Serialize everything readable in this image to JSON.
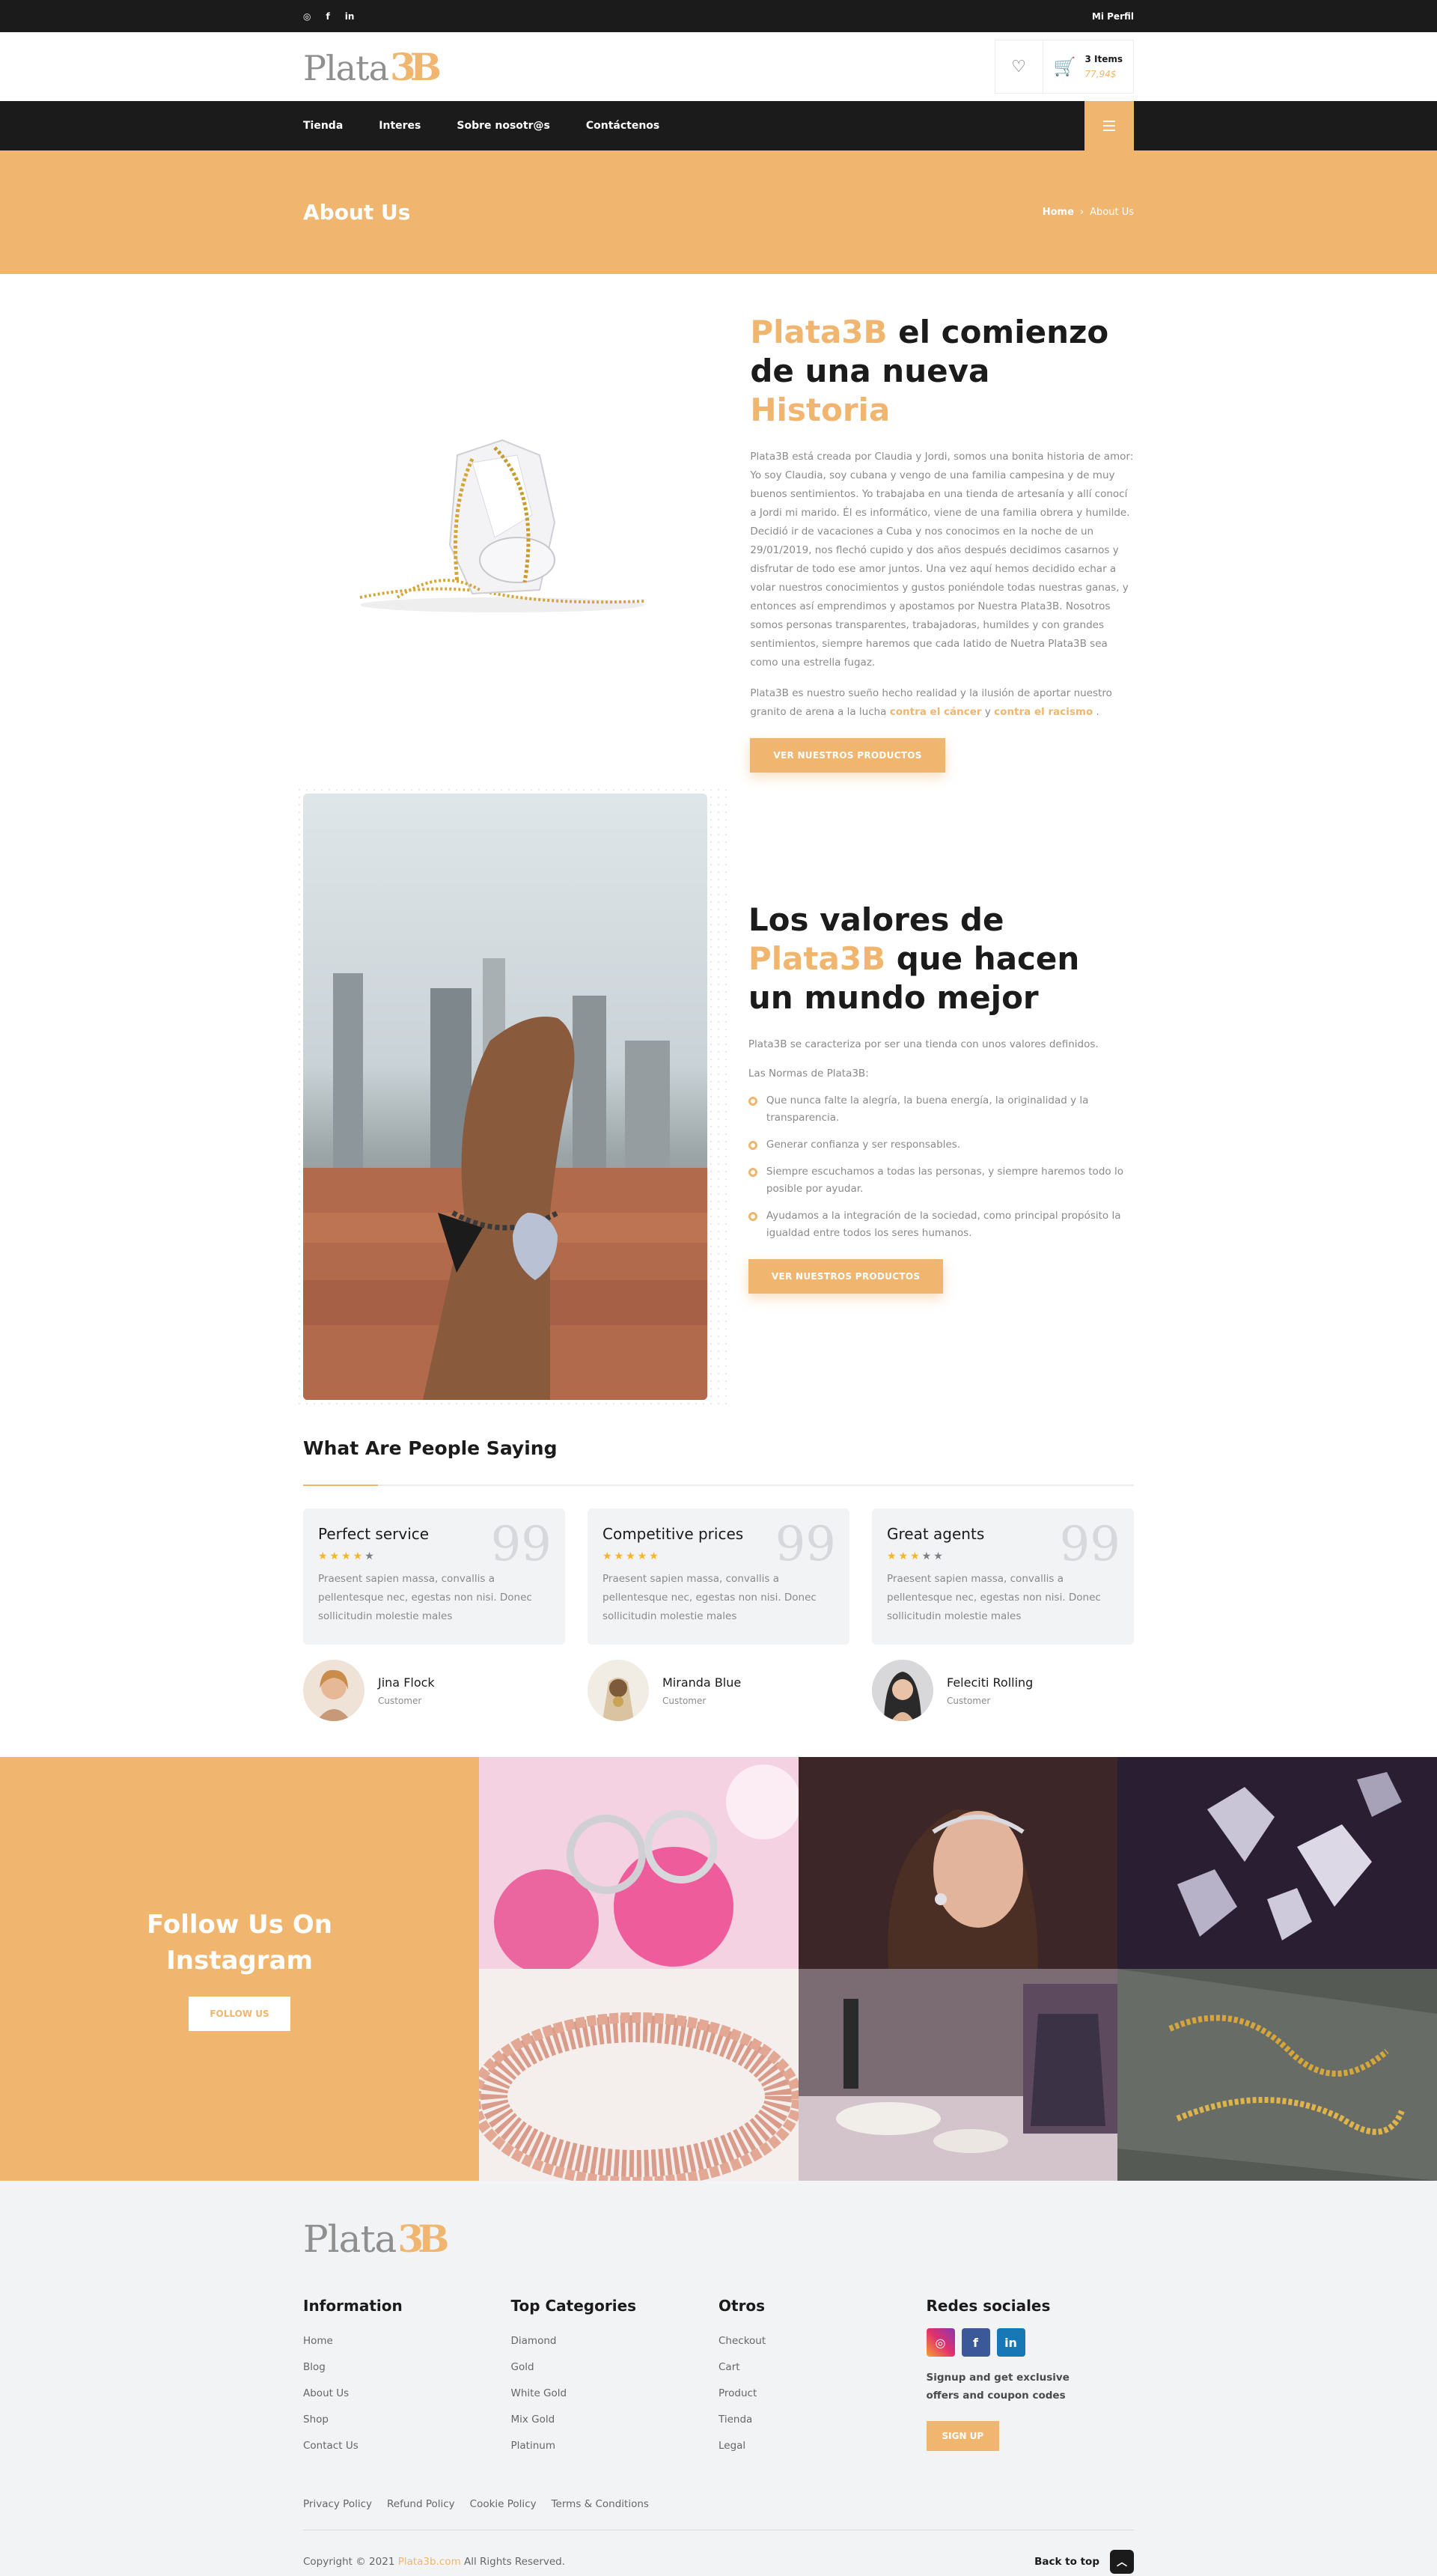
{
  "topbar": {
    "social": [
      "◎",
      "f",
      "in"
    ],
    "profile": "Mi Perfil"
  },
  "header": {
    "logo_word": "Plata",
    "logo_mark": "3B",
    "cart_items": "3 Items",
    "cart_price": "77,94$"
  },
  "nav": {
    "items": [
      "Tienda",
      "Interes",
      "Sobre nosotr@s",
      "Contáctenos"
    ]
  },
  "banner": {
    "title": "About Us",
    "crumb_home": "Home",
    "crumb_sep": "›",
    "crumb_current": "About Us"
  },
  "about": {
    "h_part1": "Plata3B",
    "h_part2": " el comienzo de una nueva ",
    "h_part3": "Historia",
    "p1": "Plata3B está creada por Claudia y Jordi, somos una bonita historia de amor: Yo soy Claudia, soy cubana y vengo de una familia campesina y de muy buenos sentimientos. Yo trabajaba en una tienda de artesanía y allí conocí a Jordi mi marido. Él es informático, viene de una familia obrera y humilde. Decidió ir de vacaciones a Cuba y nos conocimos en la noche de un 29/01/2019, nos flechó cupido y dos años después decidimos casarnos y disfrutar de todo ese amor juntos. Una vez aquí hemos decidido echar a volar nuestros conocimientos y gustos poniéndole todas nuestras ganas, y entonces así emprendimos y apostamos por Nuestra Plata3B. Nosotros somos personas transparentes, trabajadoras, humildes y con grandes sentimientos, siempre haremos que cada latido de Nuetra Plata3B sea como una estrella fugaz.",
    "p2_pre": "Plata3B es nuestro sueño hecho realidad y la ilusión de aportar nuestro granito de arena a la lucha ",
    "p2_b1": "contra el cáncer",
    "p2_mid": " y ",
    "p2_b2": "contra el racismo",
    "p2_post": " .",
    "button": "VER NUESTROS PRODUCTOS"
  },
  "values": {
    "h_part1": "Los valores de ",
    "h_part2": "Plata3B",
    "h_part3": " que hacen un mundo mejor",
    "p1": "Plata3B se caracteriza por ser una tienda con unos valores definidos.",
    "p2": "Las Normas de Plata3B:",
    "items": [
      "Que nunca falte la alegría, la buena energía, la originalidad y la transparencia.",
      "Generar confianza y ser responsables.",
      "Siempre escuchamos a todas las personas, y siempre haremos todo lo posible por ayudar.",
      "Ayudamos a la integración de la sociedad, como principal propósito la igualdad entre todos los seres humanos."
    ],
    "button": "VER NUESTROS PRODUCTOS"
  },
  "testimonials": {
    "title": "What Are People Saying",
    "quote_mark": "99",
    "cards": [
      {
        "title": "Perfect service",
        "rating": 4,
        "body": "Praesent sapien massa, convallis a pellentesque nec, egestas non nisi. Donec sollicitudin molestie males",
        "name": "Jina Flock",
        "role": "Customer"
      },
      {
        "title": "Competitive prices",
        "rating": 5,
        "body": "Praesent sapien massa, convallis a pellentesque nec, egestas non nisi. Donec sollicitudin molestie males",
        "name": "Miranda Blue",
        "role": "Customer"
      },
      {
        "title": "Great agents",
        "rating": 3,
        "body": "Praesent sapien massa, convallis a pellentesque nec, egestas non nisi. Donec sollicitudin molestie males",
        "name": "Feleciti Rolling",
        "role": "Customer"
      }
    ]
  },
  "instagram": {
    "title": "Follow Us On Instagram",
    "button": "FOLLOW US"
  },
  "footer": {
    "logo_word": "Plata",
    "logo_mark": "3B",
    "columns": [
      {
        "title": "Information",
        "links": [
          "Home",
          "Blog",
          "About Us",
          "Shop",
          "Contact Us"
        ]
      },
      {
        "title": "Top Categories",
        "links": [
          "Diamond",
          "Gold",
          "White Gold",
          "Mix Gold",
          "Platinum"
        ]
      },
      {
        "title": "Otros",
        "links": [
          "Checkout",
          "Cart",
          "Product",
          "Tienda",
          "Legal"
        ]
      }
    ],
    "social_title": "Redes sociales",
    "social_icons": [
      "◎",
      "f",
      "in"
    ],
    "signup_text": "Signup and get exclusive offers and coupon codes",
    "signup_button": "SIGN UP",
    "policies": [
      "Privacy Policy",
      "Refund Policy",
      "Cookie Policy",
      "Terms & Conditions"
    ],
    "copy_pre": "Copyright © 2021 ",
    "copy_brand": "Plata3b.com",
    "copy_post": " All Rights Reserved.",
    "back_to_top": "Back to top",
    "up_glyph": "︿"
  },
  "colors": {
    "accent": "#f0b56e",
    "dark": "#1b1b1b",
    "footer_bg": "#f2f3f5"
  }
}
